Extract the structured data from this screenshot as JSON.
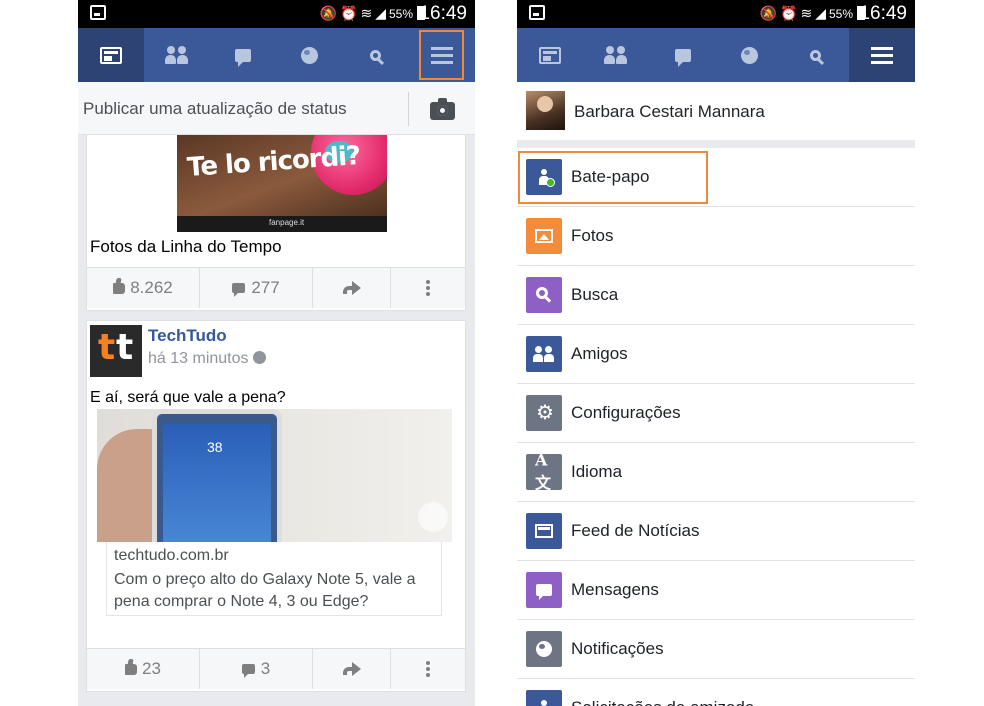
{
  "status_bar": {
    "battery": "55%",
    "time": "16:49",
    "icons": "🔕⏰≋◢"
  },
  "navbar": {
    "items": [
      "news-feed",
      "friend-requests",
      "messages",
      "notifications",
      "search",
      "more-menu"
    ]
  },
  "left": {
    "composer": {
      "placeholder": "Publicar uma atualização de status"
    },
    "post1": {
      "image_text": "Te lo ricordi?",
      "image_credit": "fanpage.it",
      "title": "Fotos da Linha do Tempo",
      "likes": "8.262",
      "comments": "277"
    },
    "post2": {
      "avatar_text": "tt",
      "page_name": "TechTudo",
      "time": "há 13 minutos",
      "text": "E aí, será que vale a pena?",
      "phone_clock": "38",
      "link_domain": "techtudo.com.br",
      "link_description": "Com o preço alto do Galaxy Note 5, vale a pena comprar o Note 4, 3 ou Edge?",
      "likes": "23",
      "comments": "3"
    }
  },
  "right": {
    "profile_name": "Barbara Cestari Mannara",
    "menu": [
      {
        "label": "Bate-papo",
        "color": "#3b5998"
      },
      {
        "label": "Fotos",
        "color": "#f38b3b"
      },
      {
        "label": "Busca",
        "color": "#8e5fc4"
      },
      {
        "label": "Amigos",
        "color": "#3b5998"
      },
      {
        "label": "Configurações",
        "color": "#6d7484"
      },
      {
        "label": "Idioma",
        "color": "#6d7484"
      },
      {
        "label": "Feed de Notícias",
        "color": "#3b5998"
      },
      {
        "label": "Mensagens",
        "color": "#8e5fc4"
      },
      {
        "label": "Notificações",
        "color": "#6d7484"
      },
      {
        "label": "Solicitações de amizade",
        "color": "#3b5998"
      }
    ]
  },
  "highlight_color": "#f08a3a",
  "brand_color": "#3b5998"
}
